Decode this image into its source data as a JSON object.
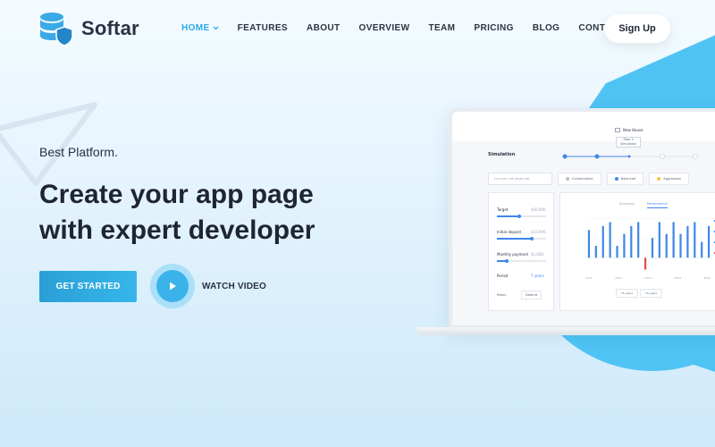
{
  "brand": {
    "name": "Softar"
  },
  "nav": {
    "items": [
      {
        "label": "HOME",
        "active": true
      },
      {
        "label": "FEATURES",
        "active": false
      },
      {
        "label": "ABOUT",
        "active": false
      },
      {
        "label": "OVERVIEW",
        "active": false
      },
      {
        "label": "TEAM",
        "active": false
      },
      {
        "label": "PRICING",
        "active": false
      },
      {
        "label": "BLOG",
        "active": false
      },
      {
        "label": "CONTACT",
        "active": false
      }
    ],
    "signup_label": "Sign Up"
  },
  "hero": {
    "eyebrow": "Best Platform.",
    "headline_line1": "Create your app page",
    "headline_line2": "with expert developer",
    "cta_label": "GET STARTED",
    "video_label": "WATCH VIDEO"
  },
  "mockup": {
    "house_label": "New House",
    "tooltip_line1": "Step 3",
    "tooltip_line2": "Simulation",
    "simulation_label": "Simulation",
    "search_placeholder": "Go over risk asset pdf",
    "risk_options": [
      {
        "label": "Conservative",
        "color": "#b8c2cf"
      },
      {
        "label": "Balanced",
        "color": "#3f86ea"
      },
      {
        "label": "Aggressive",
        "color": "#f5c542"
      }
    ],
    "fields": [
      {
        "label": "Target",
        "value": "$50,000",
        "fill": 0.45
      },
      {
        "label": "Initial deposit",
        "value": "$10,000",
        "fill": 0.7
      },
      {
        "label": "Monthly payment",
        "value": "$1,000",
        "fill": 0.2
      }
    ],
    "period_label": "Period",
    "period_value": "7 years",
    "reset_label": "Reset",
    "default_label": "Default",
    "chart_tabs": [
      "Snapshot",
      "Performance"
    ],
    "x_labels": [
      "2021",
      "2022",
      "2023",
      "2024",
      "2025"
    ],
    "range_pills": [
      "15 years",
      "10 years"
    ],
    "colors": {
      "accent": "#3f86ea",
      "negative": "#e5484d",
      "brand": "#2aa9e8",
      "blob": "#4fc3f4"
    }
  },
  "chart_data": {
    "type": "bar",
    "values": [
      7,
      3,
      8,
      9,
      3,
      6,
      8,
      9,
      -3,
      5,
      9,
      6,
      9,
      6,
      8,
      9,
      4,
      8
    ],
    "ylim": [
      -4,
      10
    ]
  }
}
